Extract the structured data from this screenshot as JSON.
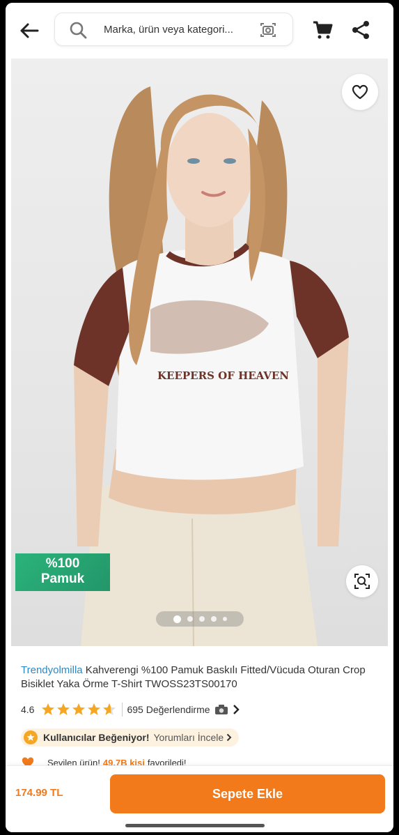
{
  "header": {
    "search_placeholder": "Marka, ürün veya kategori..."
  },
  "gallery": {
    "badge_line1": "%100",
    "badge_line2": "Pamuk",
    "image_count": 5,
    "active_index": 0,
    "print_text": "KEEPERS OF HEAVEN"
  },
  "product": {
    "brand": "Trendyolmilla",
    "name": " Kahverengi %100 Pamuk Baskılı Fitted/Vücuda Oturan Crop Bisiklet Yaka Örme T-Shirt TWOSS23TS00170",
    "rating": "4.6",
    "rating_value": 4.6,
    "reviews": "695 Değerlendirme"
  },
  "liked": {
    "text": "Kullanıcılar Beğeniyor!",
    "link": "Yorumları İncele"
  },
  "favorites": {
    "prefix": "Sevilen ürün!",
    "count": "49.7B kişi",
    "suffix": "favoriledi!"
  },
  "bottom": {
    "price": "174.99 TL",
    "add_to_cart": "Sepete Ekle"
  },
  "colors": {
    "accent": "#f27a1a",
    "brand_link": "#2a8ac6",
    "star": "#f5a623",
    "badge": "#2bb37a"
  }
}
